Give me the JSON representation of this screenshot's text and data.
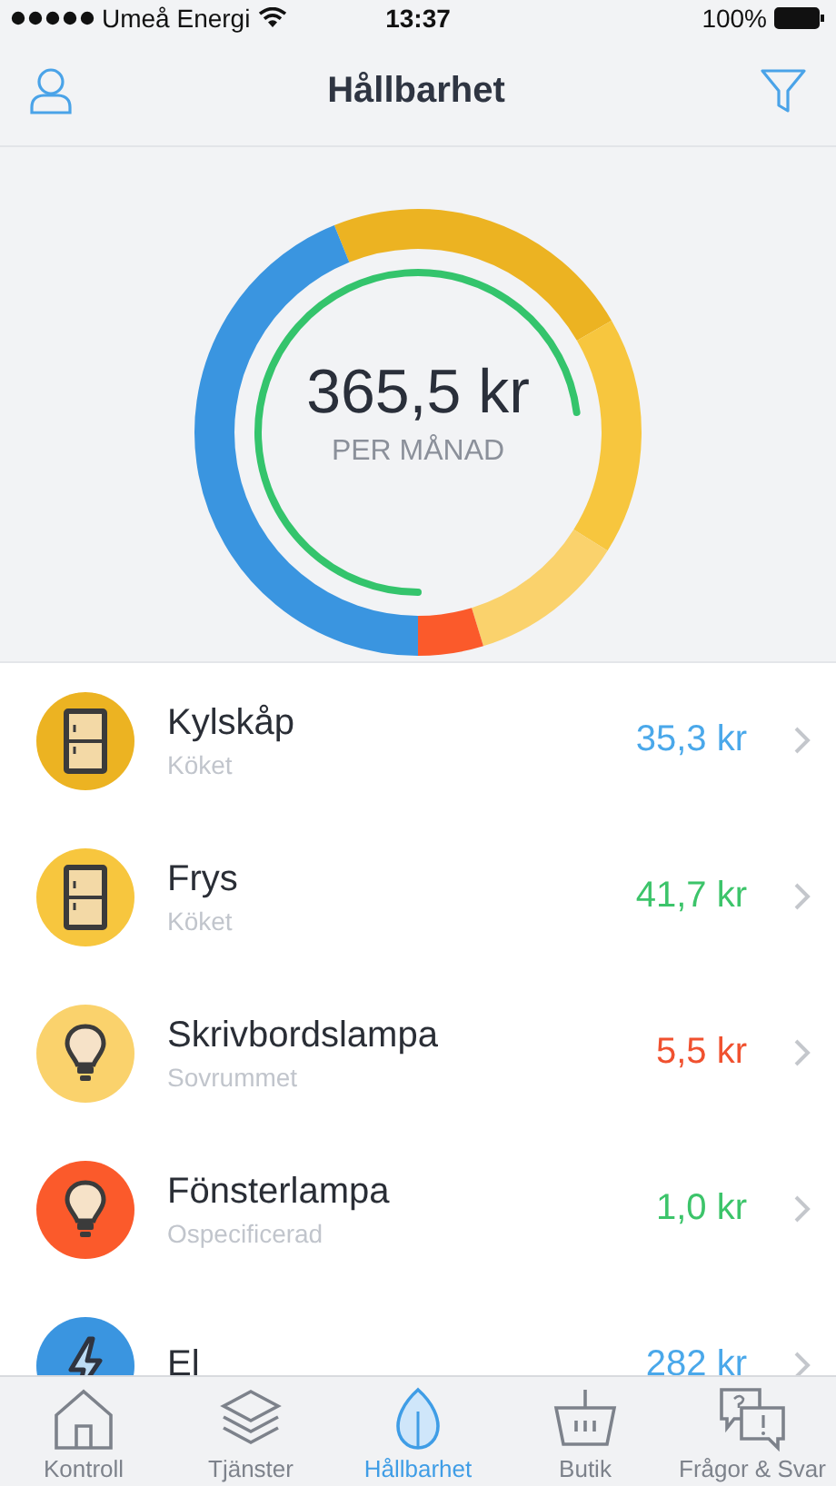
{
  "status_bar": {
    "carrier": "Umeå Energi",
    "time": "13:37",
    "battery": "100%"
  },
  "nav": {
    "title": "Hållbarhet"
  },
  "summary": {
    "amount": "365,5 kr",
    "caption": "PER MÅNAD"
  },
  "items": [
    {
      "name": "Kylskåp",
      "room": "Köket",
      "amount": {
        "text": "35,3 kr",
        "color": "#4aa8ea"
      },
      "kind": "fridge",
      "color": "#ecb322"
    },
    {
      "name": "Frys",
      "room": "Köket",
      "amount": {
        "text": "41,7 kr",
        "color": "#3cc46a"
      },
      "kind": "fridge",
      "color": "#f7c63e"
    },
    {
      "name": "Skrivbordslampa",
      "room": "Sovrummet",
      "amount": {
        "text": "5,5 kr",
        "color": "#f0512f"
      },
      "kind": "bulb",
      "color": "#fad26c"
    },
    {
      "name": "Fönsterlampa",
      "room": "Ospecificerad",
      "amount": {
        "text": "1,0 kr",
        "color": "#3cc46a"
      },
      "kind": "bulb",
      "color": "#fb5a2b"
    },
    {
      "name": "El",
      "amount": {
        "text": "282 kr",
        "color": "#4aa8ea"
      },
      "kind": "bolt",
      "color": "#3a95e0"
    }
  ],
  "tabs": [
    {
      "label": "Kontroll",
      "kind": "home",
      "selected": false
    },
    {
      "label": "Tjänster",
      "kind": "layers",
      "selected": false
    },
    {
      "label": "Hållbarhet",
      "kind": "leaf",
      "selected": true
    },
    {
      "label": "Butik",
      "kind": "basket",
      "selected": false
    },
    {
      "label": "Frågor & Svar",
      "kind": "faq",
      "selected": false
    }
  ]
}
